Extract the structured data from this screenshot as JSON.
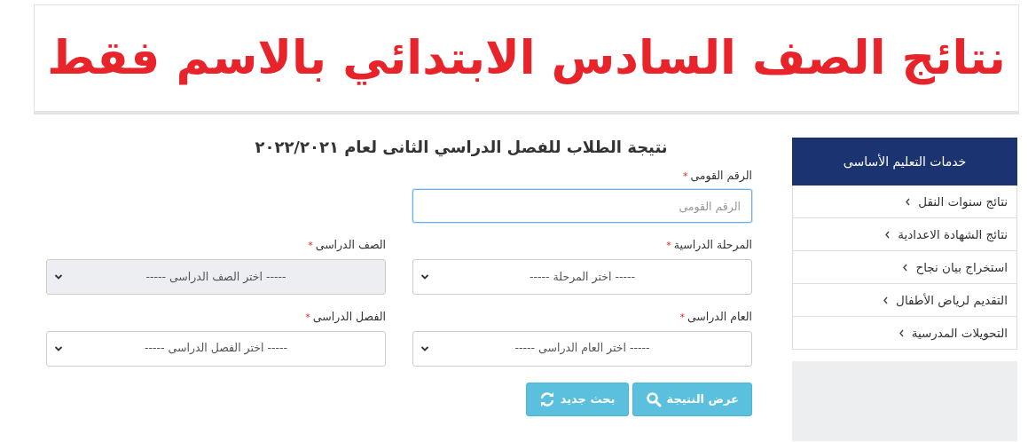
{
  "banner": {
    "title": "نتائج الصف السادس الابتدائي بالاسم فقط"
  },
  "form": {
    "title": "نتيجة الطلاب للفصل الدراسي الثانى لعام ٢٠٢٢/٢٠٢١",
    "fields": [
      {
        "kind": "text",
        "label": "الرقم القومى",
        "required_mark": "*",
        "placeholder": "الرقم القومى",
        "focused": true
      },
      {
        "kind": "select",
        "label": "المرحلة الدراسية",
        "required_mark": "*",
        "value": "----- اختر المرحلة -----",
        "disabled": false
      },
      {
        "kind": "select",
        "label": "الصف الدراسى",
        "required_mark": "*",
        "value": "----- اختر الصف الدراسى -----",
        "disabled": true
      },
      {
        "kind": "select",
        "label": "العام الدراسى",
        "required_mark": "*",
        "value": "----- اختر العام الدراسى -----",
        "disabled": false
      },
      {
        "kind": "select",
        "label": "الفصل الدراسى",
        "required_mark": "*",
        "value": "----- اختر الفصل الدراسى -----",
        "disabled": false
      }
    ],
    "buttons": [
      {
        "kind": "search",
        "label": "عرض النتيجة"
      },
      {
        "kind": "refresh",
        "label": "بحث جديد"
      }
    ]
  },
  "sidebar": {
    "title": "خدمات التعليم الأساسى",
    "items": [
      {
        "label": "نتائج سنوات النقل"
      },
      {
        "label": "نتائج الشهادة الاعدادية"
      },
      {
        "label": "استخراج بيان نجاح"
      },
      {
        "label": "التقديم لرياض الأطفال"
      },
      {
        "label": "التحويلات المدرسية"
      }
    ]
  }
}
